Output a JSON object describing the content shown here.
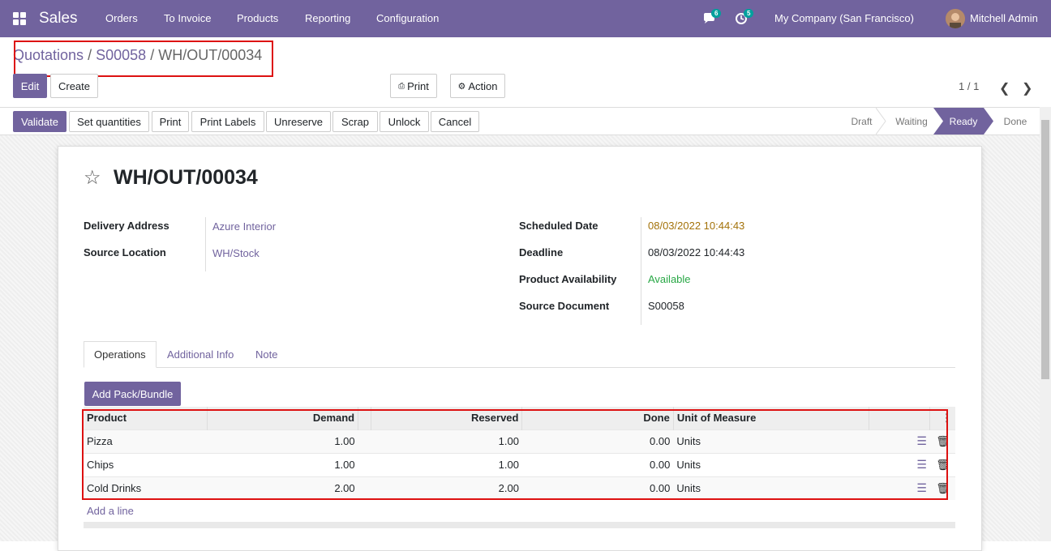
{
  "topbar": {
    "app_name": "Sales",
    "menus": [
      "Orders",
      "To Invoice",
      "Products",
      "Reporting",
      "Configuration"
    ],
    "chat_count": "6",
    "activity_count": "5",
    "company": "My Company (San Francisco)",
    "user": "Mitchell Admin"
  },
  "breadcrumb": {
    "part1": "Quotations",
    "sep1": "/",
    "part2": "S00058",
    "sep2": "/",
    "current": "WH/OUT/00034"
  },
  "controls": {
    "edit": "Edit",
    "create": "Create",
    "print": "Print",
    "action": "Action",
    "pager": "1 / 1"
  },
  "actions": [
    "Validate",
    "Set quantities",
    "Print",
    "Print Labels",
    "Unreserve",
    "Scrap",
    "Unlock",
    "Cancel"
  ],
  "stages": [
    "Draft",
    "Waiting",
    "Ready",
    "Done"
  ],
  "active_stage": "Ready",
  "record": {
    "name": "WH/OUT/00034",
    "delivery_address_label": "Delivery Address",
    "delivery_address": "Azure Interior",
    "source_location_label": "Source Location",
    "source_location": "WH/Stock",
    "scheduled_date_label": "Scheduled Date",
    "scheduled_date": "08/03/2022 10:44:43",
    "deadline_label": "Deadline",
    "deadline": "08/03/2022 10:44:43",
    "availability_label": "Product Availability",
    "availability": "Available",
    "source_document_label": "Source Document",
    "source_document": "S00058"
  },
  "tabs": [
    "Operations",
    "Additional Info",
    "Note"
  ],
  "add_pack_label": "Add Pack/Bundle",
  "table": {
    "headers": [
      "Product",
      "Demand",
      "Reserved",
      "Done",
      "Unit of Measure"
    ],
    "rows": [
      {
        "product": "Pizza",
        "demand": "1.00",
        "reserved": "1.00",
        "done": "0.00",
        "uom": "Units"
      },
      {
        "product": "Chips",
        "demand": "1.00",
        "reserved": "1.00",
        "done": "0.00",
        "uom": "Units"
      },
      {
        "product": "Cold Drinks",
        "demand": "2.00",
        "reserved": "2.00",
        "done": "0.00",
        "uom": "Units"
      }
    ]
  },
  "add_line": "Add a line",
  "colors": {
    "brand": "#71639e",
    "scheduled": "#a37209",
    "available": "#28a745",
    "highlight": "#dd1111"
  }
}
